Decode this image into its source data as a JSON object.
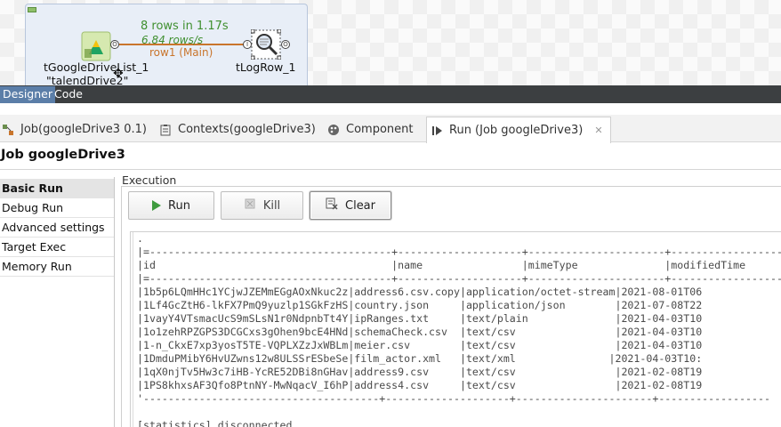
{
  "canvas": {
    "flow_rows": "8 rows in 1.17s",
    "flow_speed": "6.84 rows/s",
    "flow_name": "row1 (Main)",
    "source_label_line1": "tGoogleDriveList_1",
    "source_label_line2": "\"talendDrive2\"",
    "target_label": "tLogRow_1",
    "port_out": "O",
    "port_in": "I"
  },
  "editor_tabs": {
    "designer": "Designer",
    "code": "Code"
  },
  "view_tabs": [
    {
      "label": "Job(googleDrive3 0.1)",
      "icon": "job-icon"
    },
    {
      "label": "Contexts(googleDrive3)",
      "icon": "clipboard-icon"
    },
    {
      "label": "Component",
      "icon": "palette-icon"
    },
    {
      "label": "Run (Job googleDrive3)",
      "icon": "run-view-icon",
      "active": true
    }
  ],
  "job_title": "Job googleDrive3",
  "left_nav": [
    "Basic Run",
    "Debug Run",
    "Advanced settings",
    "Target Exec",
    "Memory Run"
  ],
  "execution": {
    "label": "Execution",
    "run_button": "Run",
    "kill_button": "Kill",
    "clear_button": "Clear"
  },
  "console": {
    "lines": [
      ".",
      "|=---------------------------------------+--------------------+----------------------+------------------",
      "|id                                      |name                |mimeType              |modifiedTime",
      "|=---------------------------------------+--------------------+----------------------+------------------",
      "|1b5p6LQmHHc1YCjwJZEMmEGgAOxNkuc2z|address6.csv.copy|application/octet-stream|2021-08-01T06",
      "|1Lf4GcZtH6-lkFX7PmQ9yuzlp1SGkFzHS|country.json     |application/json        |2021-07-08T22",
      "|1vayY4VTsmacUcS9mSLsN1r0NdpnbTt4Y|ipRanges.txt     |text/plain              |2021-04-03T10",
      "|1o1zehRPZGPS3DCGCxs3gOhen9bcE4HNd|schemaCheck.csv  |text/csv                |2021-04-03T10",
      "|1-n_CkxE7xp3yosT5TE-VQPLXZzJxWBLm|meier.csv        |text/csv                |2021-04-03T10",
      "|1DmduPMibY6HvUZwns12w8ULSSrESbeSe|film_actor.xml   |text/xml               |2021-04-03T10:",
      "|1qX0njTv5Hw3c7iHB-YcRE52DBi8nGHav|address9.csv     |text/csv                |2021-02-08T19",
      "|1PS8khxsAF3Qfo8PtnNY-MwNqacV_I6hP|address4.csv     |text/csv                |2021-02-08T19",
      "'--------------------------------------+--------------------+----------------------+------------------",
      "",
      "[statistics] disconnected"
    ]
  }
}
